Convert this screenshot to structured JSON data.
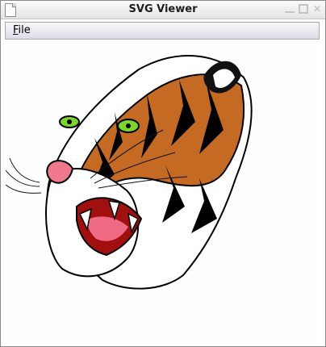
{
  "window": {
    "title": "SVG Viewer"
  },
  "menubar": {
    "items": [
      {
        "label": "File"
      }
    ]
  },
  "content": {
    "image_subject": "tiger-head-illustration"
  },
  "colors": {
    "accent_orange": "#c46a23",
    "eye_green": "#7ad629",
    "mouth_pink": "#f0788c"
  }
}
